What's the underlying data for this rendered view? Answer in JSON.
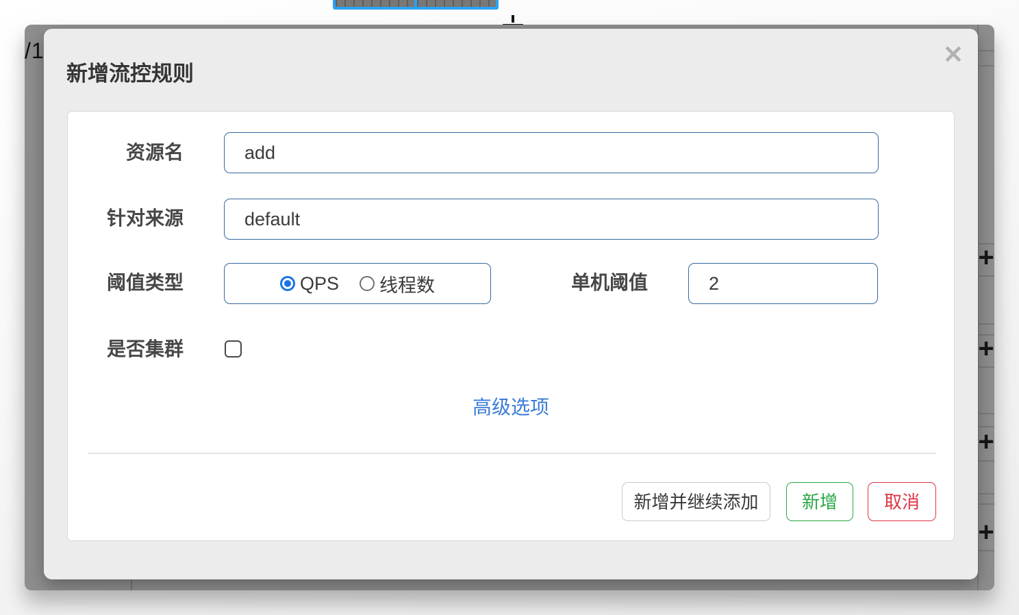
{
  "backdrop": {
    "pagination_fragment": "/1",
    "plus_glyph": "+",
    "overlay_color": "#8e8e8e",
    "selection_blue": "#2aa2f5"
  },
  "modal": {
    "title": "新增流控规则",
    "close_icon": "✕",
    "form": {
      "resource": {
        "label": "资源名",
        "value": "add"
      },
      "limit_app": {
        "label": "针对来源",
        "value": "default"
      },
      "grade": {
        "label": "阈值类型",
        "options": [
          {
            "label": "QPS",
            "selected": true
          },
          {
            "label": "线程数",
            "selected": false
          }
        ]
      },
      "threshold": {
        "label": "单机阈值",
        "value": "2"
      },
      "cluster": {
        "label": "是否集群",
        "checked": false
      },
      "advanced_link": "高级选项"
    },
    "footer": {
      "add_and_continue": "新增并继续添加",
      "add": "新增",
      "cancel": "取消"
    },
    "colors": {
      "input_border_blue": "#35689f",
      "radio_blue": "#1a73e8",
      "link_blue": "#3b7cd6",
      "success_green": "#28a745",
      "danger_red": "#dc3545",
      "dialog_bg": "#ececec"
    }
  }
}
